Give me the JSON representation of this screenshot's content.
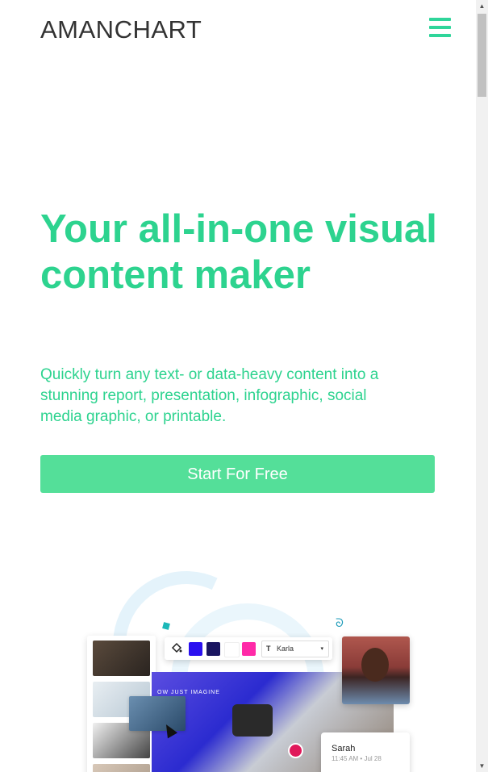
{
  "header": {
    "brand": "AMANCHART",
    "menu_icon": "hamburger-menu-icon"
  },
  "hero": {
    "title": "Your all-in-one visual content maker",
    "subtitle": "Quickly turn any text- or data-heavy content into a stunning report, presentation, infographic, social media graphic, or printable.",
    "cta_label": "Start For Free"
  },
  "illustration": {
    "toolbar": {
      "fill_icon": "paint-bucket-icon",
      "swatches": [
        "#2a10f0",
        "#1a1560",
        "#ffffff",
        "#ff2aa8"
      ],
      "font_icon": "text-t-icon",
      "font_name": "Karla",
      "dropdown_icon": "chevron-down-icon"
    },
    "canvas_text": "OW JUST IMAGINE",
    "comment": {
      "name": "Sarah",
      "time": "11:45 AM • Jul 28"
    },
    "cursor_icon": "mouse-pointer-icon"
  },
  "colors": {
    "brand_green": "#2dd38f",
    "button_green": "#54df99"
  }
}
